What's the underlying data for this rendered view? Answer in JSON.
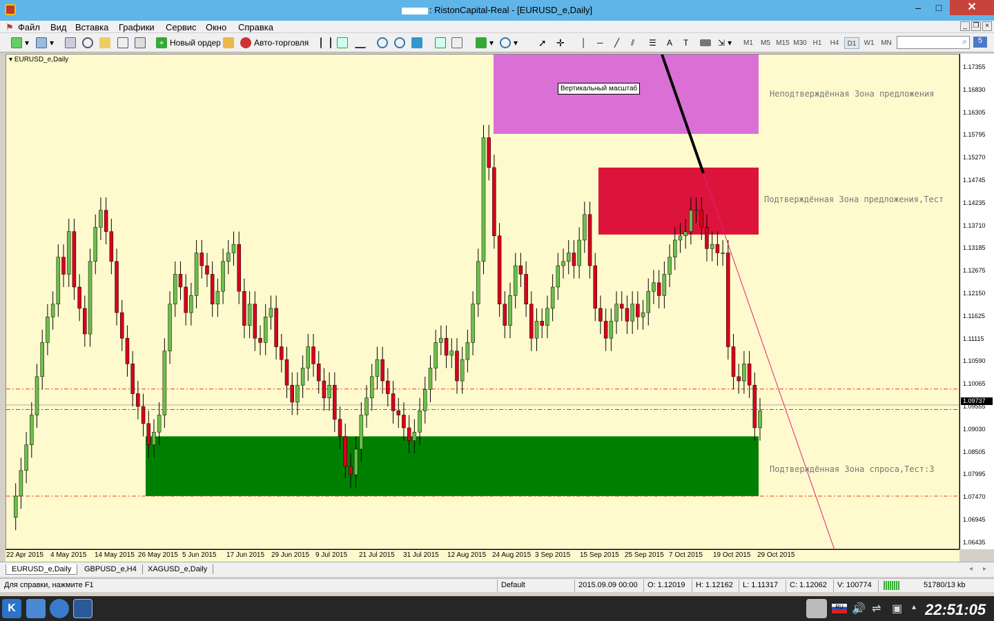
{
  "window": {
    "title": "RistonCapital-Real - [EURUSD_e,Daily]",
    "title_prefix": ":",
    "minimize": "–",
    "maximize": "□",
    "close": "✕"
  },
  "menu": {
    "items": [
      "Файл",
      "Вид",
      "Вставка",
      "Графики",
      "Сервис",
      "Окно",
      "Справка"
    ]
  },
  "toolbar": {
    "new_order": "Новый ордер",
    "auto_trading": "Авто-торговля",
    "timeframes": [
      "M1",
      "M5",
      "M15",
      "M30",
      "H1",
      "H4",
      "D1",
      "W1",
      "MN"
    ],
    "active_timeframe": "D1",
    "badge": "5"
  },
  "chart": {
    "symbol": "EURUSD_e,Daily",
    "tooltip": "Вертикальный масштаб",
    "zones": {
      "supply_unconfirmed": "Неподтверждённая Зона предложения",
      "supply_confirmed": "Подтверждённая Зона предложения,Тест",
      "demand_confirmed": "Подтверждённая Зона спроса,Тест:3"
    },
    "colors": {
      "background": "#fffacd",
      "bull": "#6cbf4b",
      "bear": "#d9001b",
      "supply_unconfirmed": "#da70d6",
      "supply_confirmed": "#dc143c",
      "demand": "#008000"
    },
    "current_price": "1.09737",
    "price_labels": [
      "1.17355",
      "1.16830",
      "1.16305",
      "1.15795",
      "1.15270",
      "1.14745",
      "1.14235",
      "1.13710",
      "1.13185",
      "1.12675",
      "1.12150",
      "1.11625",
      "1.11115",
      "1.10590",
      "1.10065",
      "1.09555",
      "1.09030",
      "1.08505",
      "1.07995",
      "1.07470",
      "1.06945",
      "1.06435"
    ],
    "time_labels": [
      "22 Apr 2015",
      "4 May 2015",
      "14 May 2015",
      "26 May 2015",
      "5 Jun 2015",
      "17 Jun 2015",
      "29 Jun 2015",
      "9 Jul 2015",
      "21 Jul 2015",
      "31 Jul 2015",
      "12 Aug 2015",
      "24 Aug 2015",
      "3 Sep 2015",
      "15 Sep 2015",
      "25 Sep 2015",
      "7 Oct 2015",
      "19 Oct 2015",
      "29 Oct 2015"
    ]
  },
  "chart_data": {
    "type": "candlestick",
    "symbol": "EURUSD_e",
    "timeframe": "Daily",
    "ylim": [
      1.06435,
      1.1795
    ],
    "zones": [
      {
        "name": "Неподтверждённая Зона предложения",
        "from": 1.1609,
        "to": 1.1795
      },
      {
        "name": "Подтверждённая Зона предложения,Тест",
        "from": 1.1373,
        "to": 1.153
      },
      {
        "name": "Подтверждённая Зона спроса,Тест:3",
        "from": 1.076,
        "to": 1.09
      }
    ],
    "levels": [
      1.1011,
      1.0963,
      1.076
    ],
    "last": 1.09737
  },
  "tabs": [
    "EURUSD_e,Daily",
    "GBPUSD_e,H4",
    "XAGUSD_e,Daily"
  ],
  "status": {
    "help": "Для справки, нажмите F1",
    "profile": "Default",
    "datetime": "2015.09.09 00:00",
    "open": "O: 1.12019",
    "high": "H: 1.12162",
    "low": "L: 1.11317",
    "close": "C: 1.12062",
    "volume": "V: 100774",
    "traffic": "51780/13 kb"
  },
  "taskbar": {
    "clock": "22:51:05",
    "lang": "RU"
  }
}
